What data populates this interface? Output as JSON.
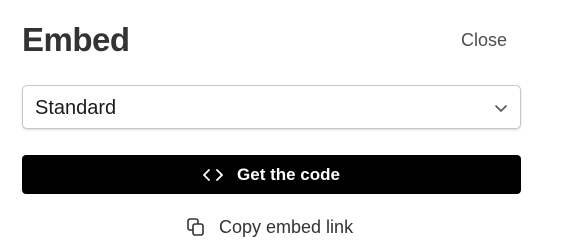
{
  "header": {
    "title": "Embed",
    "close_label": "Close"
  },
  "embed_style": {
    "selected": "Standard",
    "icon": "chevron-down-icon"
  },
  "actions": {
    "get_code_label": "Get the code",
    "get_code_icon": "code-icon",
    "copy_link_label": "Copy embed link",
    "copy_link_icon": "copy-icon"
  },
  "colors": {
    "primary_button_bg": "#000000",
    "primary_button_text": "#ffffff",
    "title_text": "#333333"
  }
}
